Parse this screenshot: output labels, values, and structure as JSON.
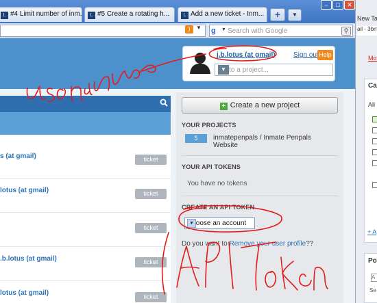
{
  "browser": {
    "tabs": [
      {
        "label": "#4 Limit number of inm..."
      },
      {
        "label": "#5 Create a rotating h..."
      },
      {
        "label": "Add a new ticket - Inm..."
      }
    ],
    "new_tab": "+",
    "search_placeholder": "Search with Google"
  },
  "right_window": {
    "tab_text": "New Ta",
    "addr_text": "ail - 3bm",
    "link_text": "Mov",
    "box_title": "Ca",
    "all_label": "All",
    "plus_link": "+ A",
    "box2_title": "Po",
    "field_text": "A",
    "small_text": "Se"
  },
  "header": {
    "username": "j.b.lotus (at gmail)",
    "sign_out": "Sign out",
    "help": "Help",
    "project_placeholder": "Go to a project..."
  },
  "list": {
    "rows": [
      {
        "link": "s (at gmail)",
        "ticket": "ticket"
      },
      {
        "link": "lotus (at gmail)",
        "ticket": "ticket"
      },
      {
        "link": "",
        "ticket": "ticket"
      },
      {
        "link": ".b.lotus (at gmail)",
        "ticket": "ticket"
      },
      {
        "link": "lotus (at gmail)",
        "ticket": "ticket"
      }
    ]
  },
  "sidebar": {
    "create_project": "Create a new project",
    "your_projects_title": "YOUR PROJECTS",
    "project_count": "5",
    "project_name": "inmatepenpals / Inmate Penpals Website",
    "api_tokens_title": "YOUR API TOKENS",
    "no_tokens": "You have no tokens",
    "create_token_title": "CREATE AN API TOKEN",
    "account_select": "Choose an account",
    "remove_prefix": "Do you want to ",
    "remove_link": "Remove your user profile",
    "remove_suffix": "??"
  },
  "annotations": {
    "username": "username",
    "api_token": "API token"
  },
  "colors": {
    "header_blue": "#4d91cc",
    "link_blue": "#2a73b8",
    "annotation_red": "#e11b1b",
    "help_orange": "#f08a1d"
  }
}
